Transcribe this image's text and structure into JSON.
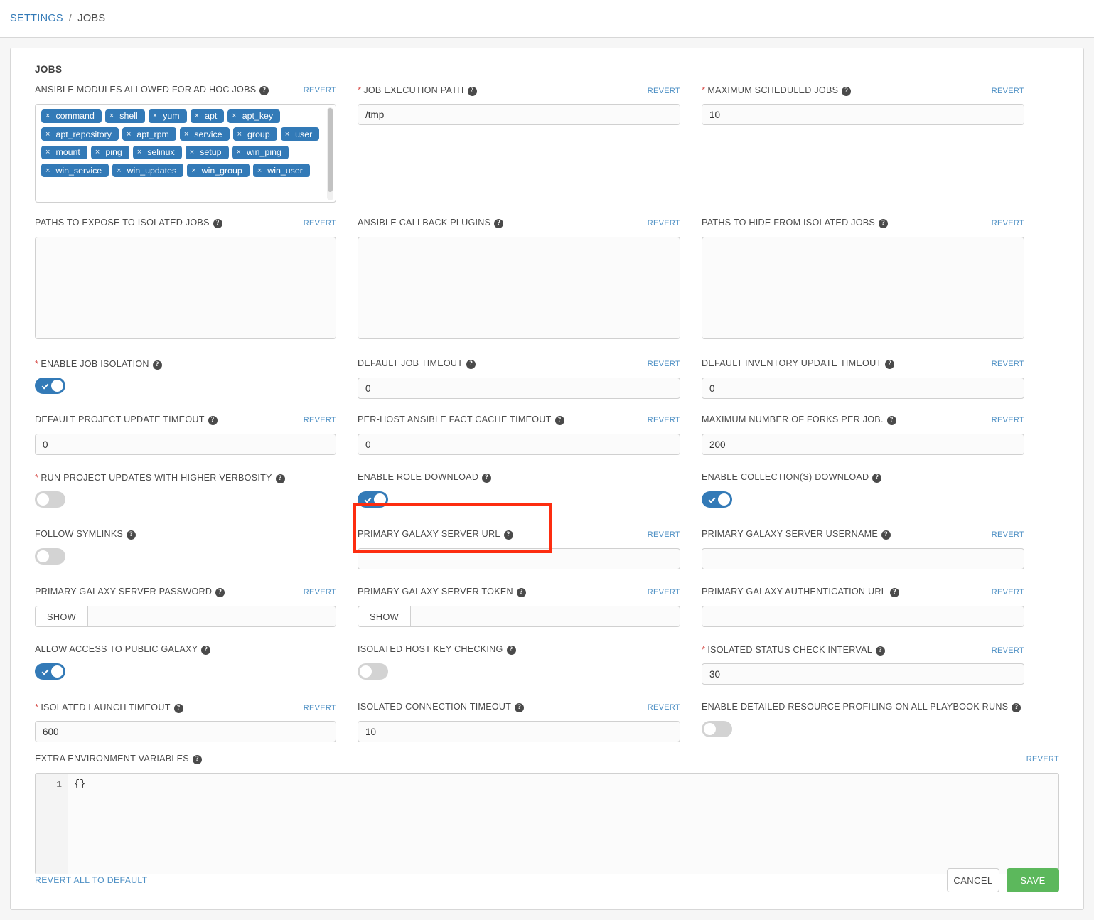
{
  "breadcrumb": {
    "root": "SETTINGS",
    "separator": "/",
    "current": "JOBS"
  },
  "card": {
    "title": "JOBS"
  },
  "labels": {
    "revert": "REVERT",
    "show": "SHOW",
    "revert_all": "REVERT ALL TO DEFAULT",
    "cancel": "CANCEL",
    "save": "SAVE",
    "help_glyph": "?",
    "required_glyph": "*",
    "tag_remove_glyph": "×"
  },
  "fields": {
    "ansible_modules": {
      "label": "ANSIBLE MODULES ALLOWED FOR AD HOC JOBS",
      "tags": [
        "command",
        "shell",
        "yum",
        "apt",
        "apt_key",
        "apt_repository",
        "apt_rpm",
        "service",
        "group",
        "user",
        "mount",
        "ping",
        "selinux",
        "setup",
        "win_ping",
        "win_service",
        "win_updates",
        "win_group",
        "win_user"
      ]
    },
    "job_execution_path": {
      "label": "JOB EXECUTION PATH",
      "value": "/tmp",
      "required": true
    },
    "maximum_scheduled_jobs": {
      "label": "MAXIMUM SCHEDULED JOBS",
      "value": "10",
      "required": true
    },
    "paths_expose_isolated": {
      "label": "PATHS TO EXPOSE TO ISOLATED JOBS",
      "value": ""
    },
    "ansible_callback_plugins": {
      "label": "ANSIBLE CALLBACK PLUGINS",
      "value": ""
    },
    "paths_hide_isolated": {
      "label": "PATHS TO HIDE FROM ISOLATED JOBS",
      "value": ""
    },
    "enable_job_isolation": {
      "label": "ENABLE JOB ISOLATION",
      "state": "on",
      "required": true
    },
    "default_job_timeout": {
      "label": "DEFAULT JOB TIMEOUT",
      "value": "0"
    },
    "default_inventory_update_timeout": {
      "label": "DEFAULT INVENTORY UPDATE TIMEOUT",
      "value": "0"
    },
    "default_project_update_timeout": {
      "label": "DEFAULT PROJECT UPDATE TIMEOUT",
      "value": "0"
    },
    "per_host_fact_cache_timeout": {
      "label": "PER-HOST ANSIBLE FACT CACHE TIMEOUT",
      "value": "0"
    },
    "maximum_forks_per_job": {
      "label": "MAXIMUM NUMBER OF FORKS PER JOB.",
      "value": "200"
    },
    "run_project_updates_verbosity": {
      "label": "RUN PROJECT UPDATES WITH HIGHER VERBOSITY",
      "state": "off",
      "required": true
    },
    "enable_role_download": {
      "label": "ENABLE ROLE DOWNLOAD",
      "state": "on",
      "highlighted": true
    },
    "enable_collections_download": {
      "label": "ENABLE COLLECTION(S) DOWNLOAD",
      "state": "on"
    },
    "follow_symlinks": {
      "label": "FOLLOW SYMLINKS",
      "state": "off"
    },
    "primary_galaxy_server_url": {
      "label": "PRIMARY GALAXY SERVER URL",
      "value": ""
    },
    "primary_galaxy_server_username": {
      "label": "PRIMARY GALAXY SERVER USERNAME",
      "value": ""
    },
    "primary_galaxy_server_password": {
      "label": "PRIMARY GALAXY SERVER PASSWORD",
      "value": ""
    },
    "primary_galaxy_server_token": {
      "label": "PRIMARY GALAXY SERVER TOKEN",
      "value": ""
    },
    "primary_galaxy_auth_url": {
      "label": "PRIMARY GALAXY AUTHENTICATION URL",
      "value": ""
    },
    "allow_access_public_galaxy": {
      "label": "ALLOW ACCESS TO PUBLIC GALAXY",
      "state": "on"
    },
    "isolated_host_key_checking": {
      "label": "ISOLATED HOST KEY CHECKING",
      "state": "off"
    },
    "isolated_status_check_interval": {
      "label": "ISOLATED STATUS CHECK INTERVAL",
      "value": "30",
      "required": true
    },
    "isolated_launch_timeout": {
      "label": "ISOLATED LAUNCH TIMEOUT",
      "value": "600",
      "required": true
    },
    "isolated_connection_timeout": {
      "label": "ISOLATED CONNECTION TIMEOUT",
      "value": "10"
    },
    "enable_detailed_resource_profiling": {
      "label": "ENABLE DETAILED RESOURCE PROFILING ON ALL PLAYBOOK RUNS",
      "state": "off"
    },
    "extra_environment_variables": {
      "label": "EXTRA ENVIRONMENT VARIABLES",
      "line_number": "1",
      "value": "{}"
    }
  },
  "colors": {
    "accent": "#337ab7",
    "link": "#4d8fc4",
    "required": "#d9534f",
    "save": "#5cb85c",
    "highlight": "#fd2d10"
  }
}
